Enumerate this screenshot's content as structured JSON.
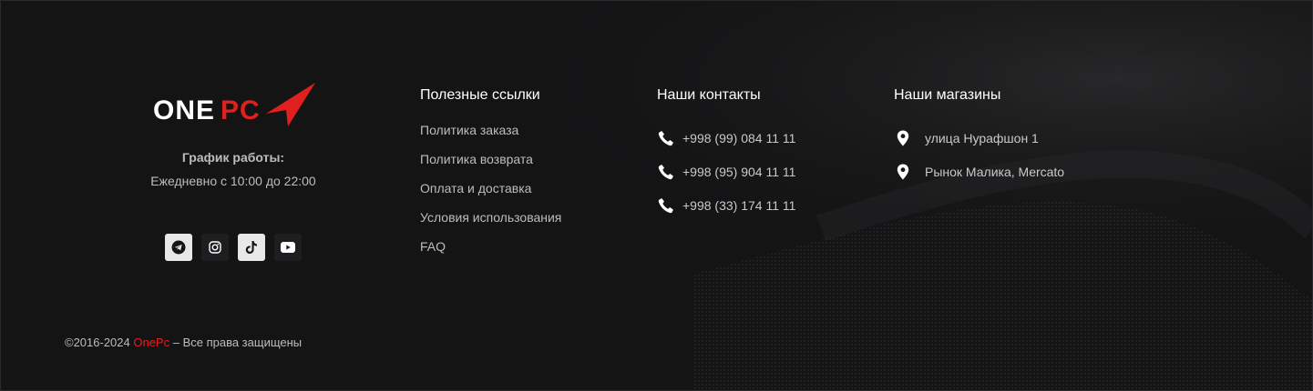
{
  "brand": {
    "logo_text_white": "ONE",
    "logo_text_red": "PC",
    "hours_title": "График работы:",
    "hours_text": "Ежедневно с 10:00 до 22:00",
    "accent_color": "#e0201f"
  },
  "socials": [
    {
      "name": "telegram-icon",
      "style": "light"
    },
    {
      "name": "instagram-icon",
      "style": "dark"
    },
    {
      "name": "tiktok-icon",
      "style": "light"
    },
    {
      "name": "youtube-icon",
      "style": "dark"
    }
  ],
  "useful_links": {
    "title": "Полезные ссылки",
    "items": [
      "Политика заказа",
      "Политика возврата",
      "Оплата и доставка",
      "Условия использования",
      "FAQ"
    ]
  },
  "contacts": {
    "title": "Наши контакты",
    "phones": [
      "+998 (99) 084 11 11",
      "+998 (95) 904 11 11",
      "+998 (33) 174 11 11"
    ]
  },
  "stores": {
    "title": "Наши магазины",
    "items": [
      "улица Нурафшон 1",
      "Рынок Малика, Mercato"
    ]
  },
  "copyright": {
    "prefix": "©2016-2024 ",
    "brand": "OnePc",
    "suffix": " – Все права защищены"
  }
}
